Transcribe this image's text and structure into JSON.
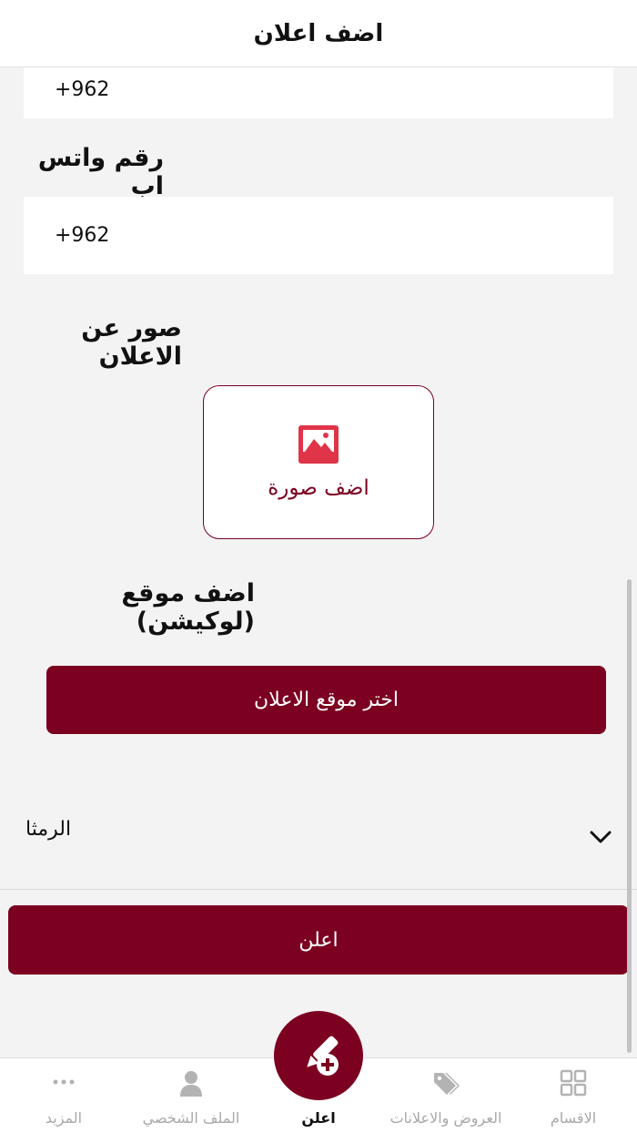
{
  "header": {
    "title": "اضف اعلان"
  },
  "phone_field": {
    "value": "+962"
  },
  "whatsapp": {
    "label": "رقم واتس اب",
    "value": "+962"
  },
  "photos": {
    "label": "صور عن الاعلان",
    "add_label": "اضف صورة"
  },
  "location": {
    "label": "اضف موقع (لوكيشن)",
    "button_label": "اختر موقع الاعلان"
  },
  "city_select": {
    "selected": "الرمثا"
  },
  "submit": {
    "label": "اعلن"
  },
  "tabbar": {
    "tabs": [
      {
        "label": "المزيد",
        "icon": "more-dots-icon",
        "active": false
      },
      {
        "label": "الملف الشخصي",
        "icon": "person-icon",
        "active": false
      },
      {
        "label": "اعلن",
        "icon": "edit-add-icon",
        "active": true
      },
      {
        "label": "العروض والاعلانات",
        "icon": "tags-icon",
        "active": false
      },
      {
        "label": "الاقسام",
        "icon": "grid-icon",
        "active": false
      }
    ]
  },
  "colors": {
    "brand": "#7c0020",
    "accent_icon": "#e03448",
    "background": "#f3f3f3",
    "inactive": "#a9a9a9"
  }
}
